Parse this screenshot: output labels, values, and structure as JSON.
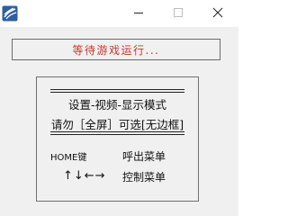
{
  "window": {
    "icon": "app-icon",
    "controls": {
      "minimize_icon": "minimize-icon",
      "maximize_icon": "maximize-icon",
      "close_icon": "close-icon"
    }
  },
  "status": {
    "text": "等待游戏运行..."
  },
  "info": {
    "title": "设置-视频-显示模式",
    "subtitle": "请勿［全屏］可选[无边框]",
    "shortcuts": [
      {
        "key": "HOME键",
        "action": "呼出菜单"
      },
      {
        "key": "↑↓←→",
        "action": "控制菜单"
      }
    ]
  },
  "colors": {
    "status_text": "#c0392b",
    "background": "#f0f0f0"
  }
}
